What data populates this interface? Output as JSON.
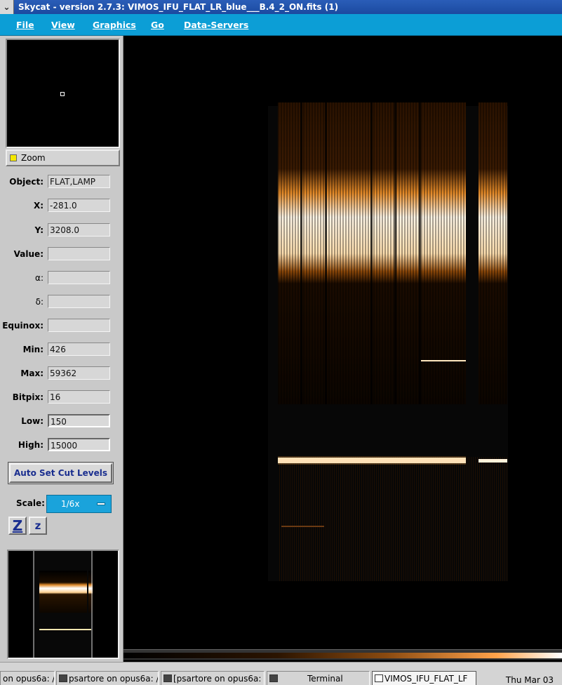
{
  "window": {
    "title": "Skycat - version 2.7.3: VIMOS_IFU_FLAT_LR_blue___B.4_2_ON.fits (1)",
    "menu_glyph": "⌄"
  },
  "menubar": {
    "items": [
      "File",
      "View",
      "Graphics",
      "Go",
      "Data-Servers"
    ]
  },
  "panel": {
    "zoom_label": "Zoom",
    "fields": [
      {
        "label": "Object:",
        "value": "FLAT,LAMP"
      },
      {
        "label": "X:",
        "value": "-281.0"
      },
      {
        "label": "Y:",
        "value": "3208.0"
      },
      {
        "label": "Value:",
        "value": ""
      },
      {
        "label": "α:",
        "value": ""
      },
      {
        "label": "δ:",
        "value": ""
      },
      {
        "label": "Equinox:",
        "value": ""
      },
      {
        "label": "Min:",
        "value": "426"
      },
      {
        "label": "Max:",
        "value": "59362"
      },
      {
        "label": "Bitpix:",
        "value": "16"
      },
      {
        "label": "Low:",
        "value": "150"
      },
      {
        "label": "High:",
        "value": "15000"
      }
    ],
    "auto_cut_label": "Auto Set Cut Levels",
    "scale_label": "Scale:",
    "scale_value": "1/6x",
    "zoom_in_label": "Z",
    "zoom_out_label": "z"
  },
  "taskbar": {
    "tasks": [
      {
        "label": "on opus6a: /"
      },
      {
        "label": "psartore on opus6a: /h"
      },
      {
        "label": "[psartore on opus6a: /"
      },
      {
        "label": "Terminal"
      },
      {
        "label": "VIMOS_IFU_FLAT_LF"
      }
    ],
    "clock": "Thu Mar 03"
  }
}
